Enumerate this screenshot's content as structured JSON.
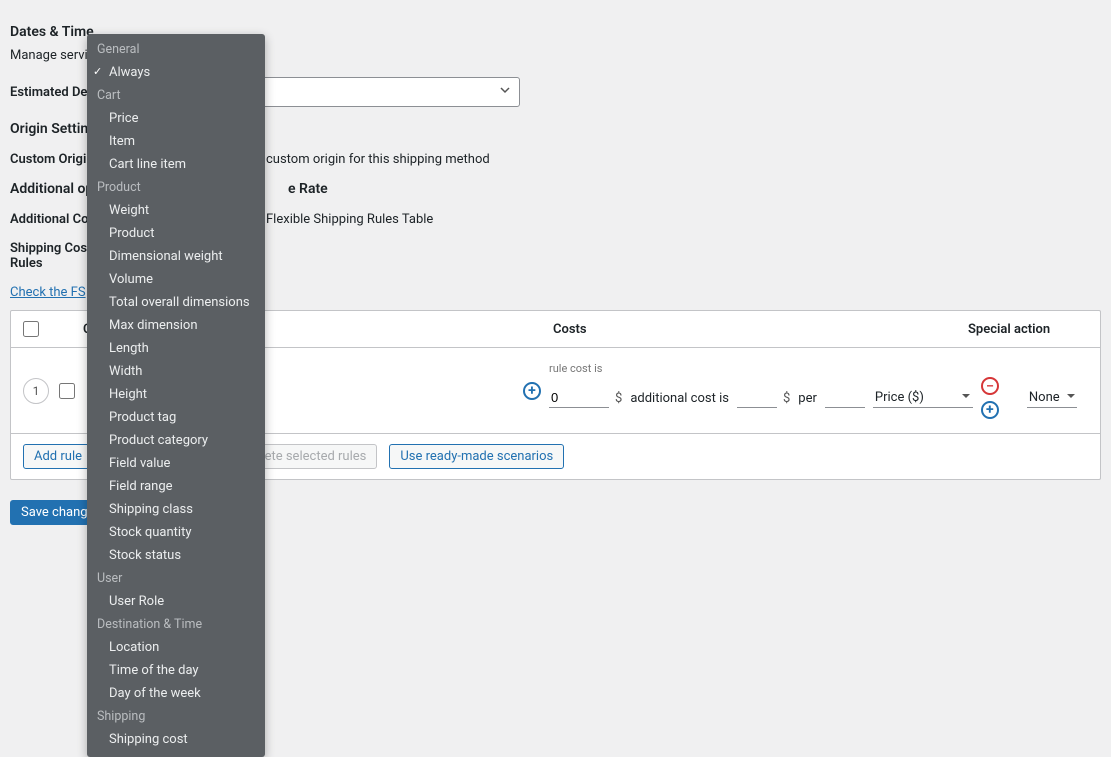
{
  "sections": {
    "dates_time": "Dates & Time",
    "dates_subtitle": "Manage service",
    "estimated_delivery": "Estimated Delivery",
    "origin_settings": "Origin Settings",
    "custom_origin_label": "Custom Origin",
    "custom_origin_text_suffix": "custom origin for this shipping method",
    "additional_options": "Additional options",
    "additional_options_suffix": "e Rate",
    "additional_cond_label": "Additional Conditions",
    "additional_cond_text": "Flexible Shipping Rules Table",
    "shipping_rules_label": "Shipping Cost\nRules",
    "check_link": "Check the FS"
  },
  "table": {
    "header_conditions": "Conditions",
    "header_costs": "Costs",
    "header_special": "Special action",
    "row_number": "1",
    "rule_cost_label": "rule cost is",
    "cost_value": "0",
    "additional_cost_is": "additional cost is",
    "per": "per",
    "price_unit": "Price ($)",
    "special_value": "None"
  },
  "buttons": {
    "add_rule": "Add rule",
    "delete_selected": "Delete selected rules",
    "use_ready": "Use ready-made scenarios",
    "save_changes": "Save changes"
  },
  "currency": "$",
  "dropdown": {
    "groups": [
      {
        "label": "General",
        "items": [
          {
            "label": "Always",
            "checked": true
          }
        ]
      },
      {
        "label": "Cart",
        "items": [
          {
            "label": "Price"
          },
          {
            "label": "Item"
          },
          {
            "label": "Cart line item"
          }
        ]
      },
      {
        "label": "Product",
        "items": [
          {
            "label": "Weight"
          },
          {
            "label": "Product"
          },
          {
            "label": "Dimensional weight"
          },
          {
            "label": "Volume"
          },
          {
            "label": "Total overall dimensions"
          },
          {
            "label": "Max dimension"
          },
          {
            "label": "Length"
          },
          {
            "label": "Width"
          },
          {
            "label": "Height"
          },
          {
            "label": "Product tag"
          },
          {
            "label": "Product category"
          },
          {
            "label": "Field value"
          },
          {
            "label": "Field range"
          },
          {
            "label": "Shipping class"
          },
          {
            "label": "Stock quantity"
          },
          {
            "label": "Stock status"
          }
        ]
      },
      {
        "label": "User",
        "items": [
          {
            "label": "User Role"
          }
        ]
      },
      {
        "label": "Destination & Time",
        "items": [
          {
            "label": "Location"
          },
          {
            "label": "Time of the day"
          },
          {
            "label": "Day of the week"
          }
        ]
      },
      {
        "label": "Shipping",
        "items": [
          {
            "label": "Shipping cost"
          }
        ]
      }
    ]
  }
}
